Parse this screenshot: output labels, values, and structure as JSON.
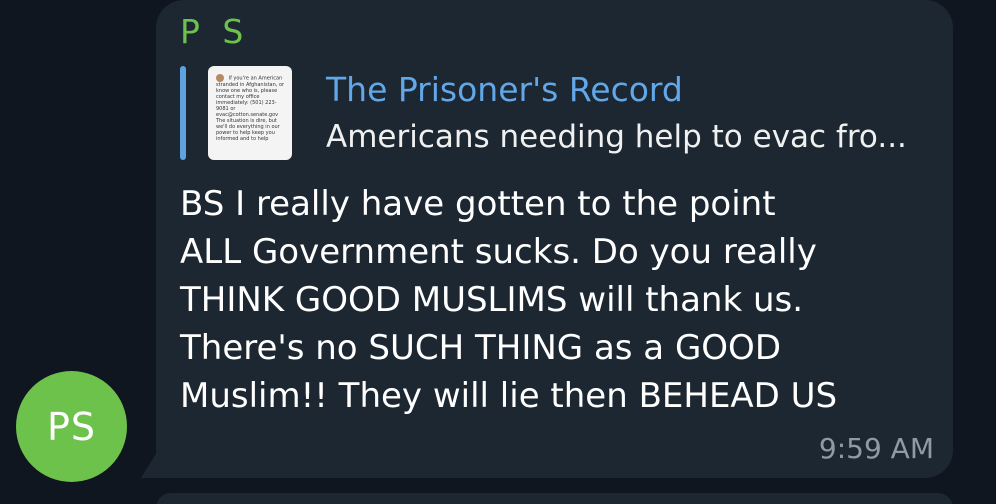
{
  "avatar": {
    "initials": "PS"
  },
  "message": {
    "sender": "P S",
    "reply": {
      "title": "The Prisoner's Record",
      "snippet": "Americans needing help to evac fro...",
      "thumbnail_text": "If you're an American stranded in Afghanistan, or know one who is, please contact my office immediately: (501) 223-9081 or evac@cotton.senate.gov The situation is dire, but we'll do everything in our power to help keep you informed and to help"
    },
    "text": "BS I really have gotten to the point\nALL Government sucks. Do you really\nTHINK GOOD MUSLIMS will thank us.\nThere's no SUCH THING as a GOOD\nMuslim!! They will lie then BEHEAD US",
    "time": "9:59 AM"
  },
  "colors": {
    "background": "#0f1620",
    "bubble": "#1c2732",
    "sender": "#6cc24a",
    "reply_accent": "#5ea3e0",
    "time": "#8f9aa6"
  }
}
